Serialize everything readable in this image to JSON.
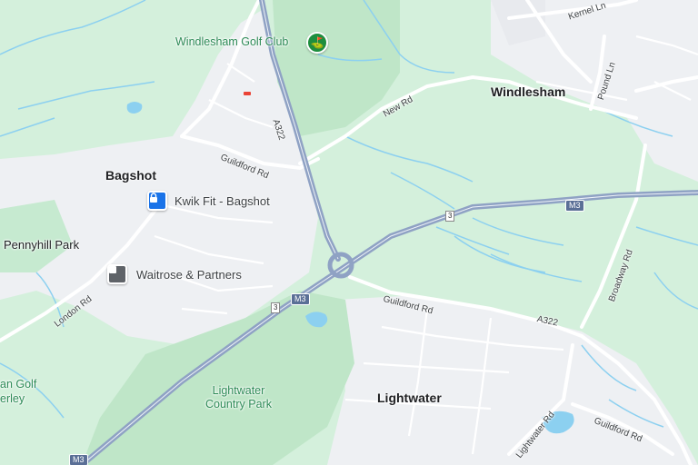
{
  "colors": {
    "land": "#d4f0dc",
    "urban": "#eef0f3",
    "park": "#bfe6c8",
    "motorway": "#8fa2c4",
    "road": "#ffffff",
    "water": "#8cd0f0",
    "poi_blue": "#1a73e8",
    "poi_grey": "#5f6368",
    "golf_green": "#1e8e3e"
  },
  "places": {
    "windlesham_golf": "Windlesham Golf Club",
    "windlesham": "Windlesham",
    "bagshot": "Bagshot",
    "pennyhill": "Pennyhill Park",
    "lightwater": "Lightwater",
    "lightwater_park_1": "Lightwater",
    "lightwater_park_2": "Country Park",
    "golf_partial_1": "an Golf",
    "golf_partial_2": "erley"
  },
  "pois": {
    "kwik_fit": "Kwik Fit - Bagshot",
    "waitrose": "Waitrose & Partners"
  },
  "roads": {
    "a322_north": "A322",
    "a322_south": "A322",
    "guildford_rd_1": "Guildford Rd",
    "guildford_rd_2": "Guildford Rd",
    "guildford_rd_3": "Guildford Rd",
    "new_rd": "New Rd",
    "kernel_ln": "Kernel Ln",
    "pound_ln": "Pound Ln",
    "broadway_rd": "Broadway Rd",
    "london_rd": "London Rd",
    "lightwater_rd": "Lightwater Rd"
  },
  "shields": {
    "m3_east": "M3",
    "m3_mid": "M3",
    "m3_sw": "M3",
    "junction_1": "3",
    "junction_2": "3"
  },
  "icons": {
    "kwik_fit": "lock-icon",
    "waitrose": "shopping-icon",
    "golf": "golf-icon"
  }
}
